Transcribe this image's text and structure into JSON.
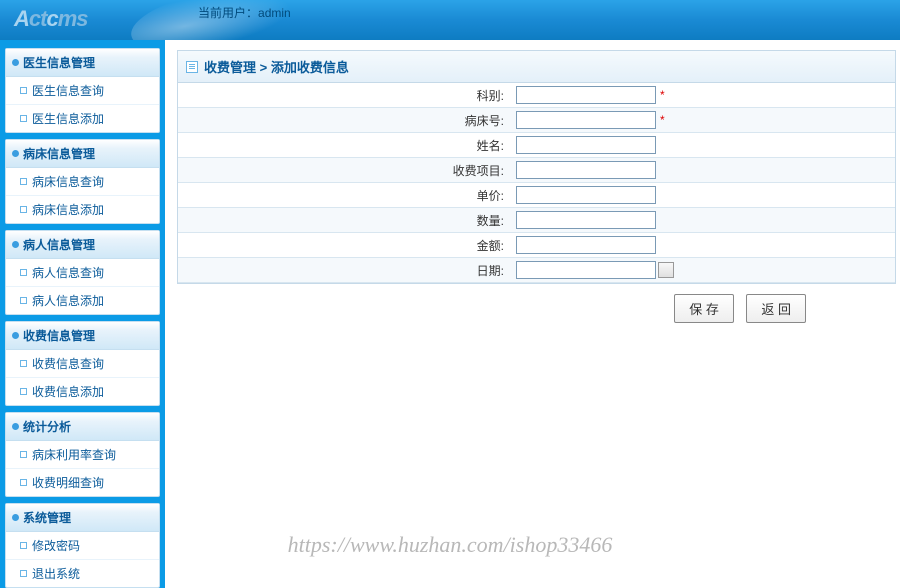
{
  "header": {
    "logo_text": "Actcms",
    "current_user_label": "当前用户：",
    "current_user_value": "admin"
  },
  "sidebar": {
    "groups": [
      {
        "title": "医生信息管理",
        "items": [
          "医生信息查询",
          "医生信息添加"
        ]
      },
      {
        "title": "病床信息管理",
        "items": [
          "病床信息查询",
          "病床信息添加"
        ]
      },
      {
        "title": "病人信息管理",
        "items": [
          "病人信息查询",
          "病人信息添加"
        ]
      },
      {
        "title": "收费信息管理",
        "items": [
          "收费信息查询",
          "收费信息添加"
        ]
      },
      {
        "title": "统计分析",
        "items": [
          "病床利用率查询",
          "收费明细查询"
        ]
      },
      {
        "title": "系统管理",
        "items": [
          "修改密码",
          "退出系统"
        ]
      }
    ]
  },
  "panel": {
    "title": "收费管理 > 添加收费信息"
  },
  "form": {
    "fields": [
      {
        "label": "科别:",
        "required": true,
        "value": ""
      },
      {
        "label": "病床号:",
        "required": true,
        "value": ""
      },
      {
        "label": "姓名:",
        "required": false,
        "value": ""
      },
      {
        "label": "收费项目:",
        "required": false,
        "value": ""
      },
      {
        "label": "单价:",
        "required": false,
        "value": ""
      },
      {
        "label": "数量:",
        "required": false,
        "value": ""
      },
      {
        "label": "金额:",
        "required": false,
        "value": ""
      },
      {
        "label": "日期:",
        "required": false,
        "value": "",
        "type": "date"
      }
    ]
  },
  "buttons": {
    "save": "保 存",
    "back": "返 回"
  },
  "watermark": "https://www.huzhan.com/ishop33466"
}
